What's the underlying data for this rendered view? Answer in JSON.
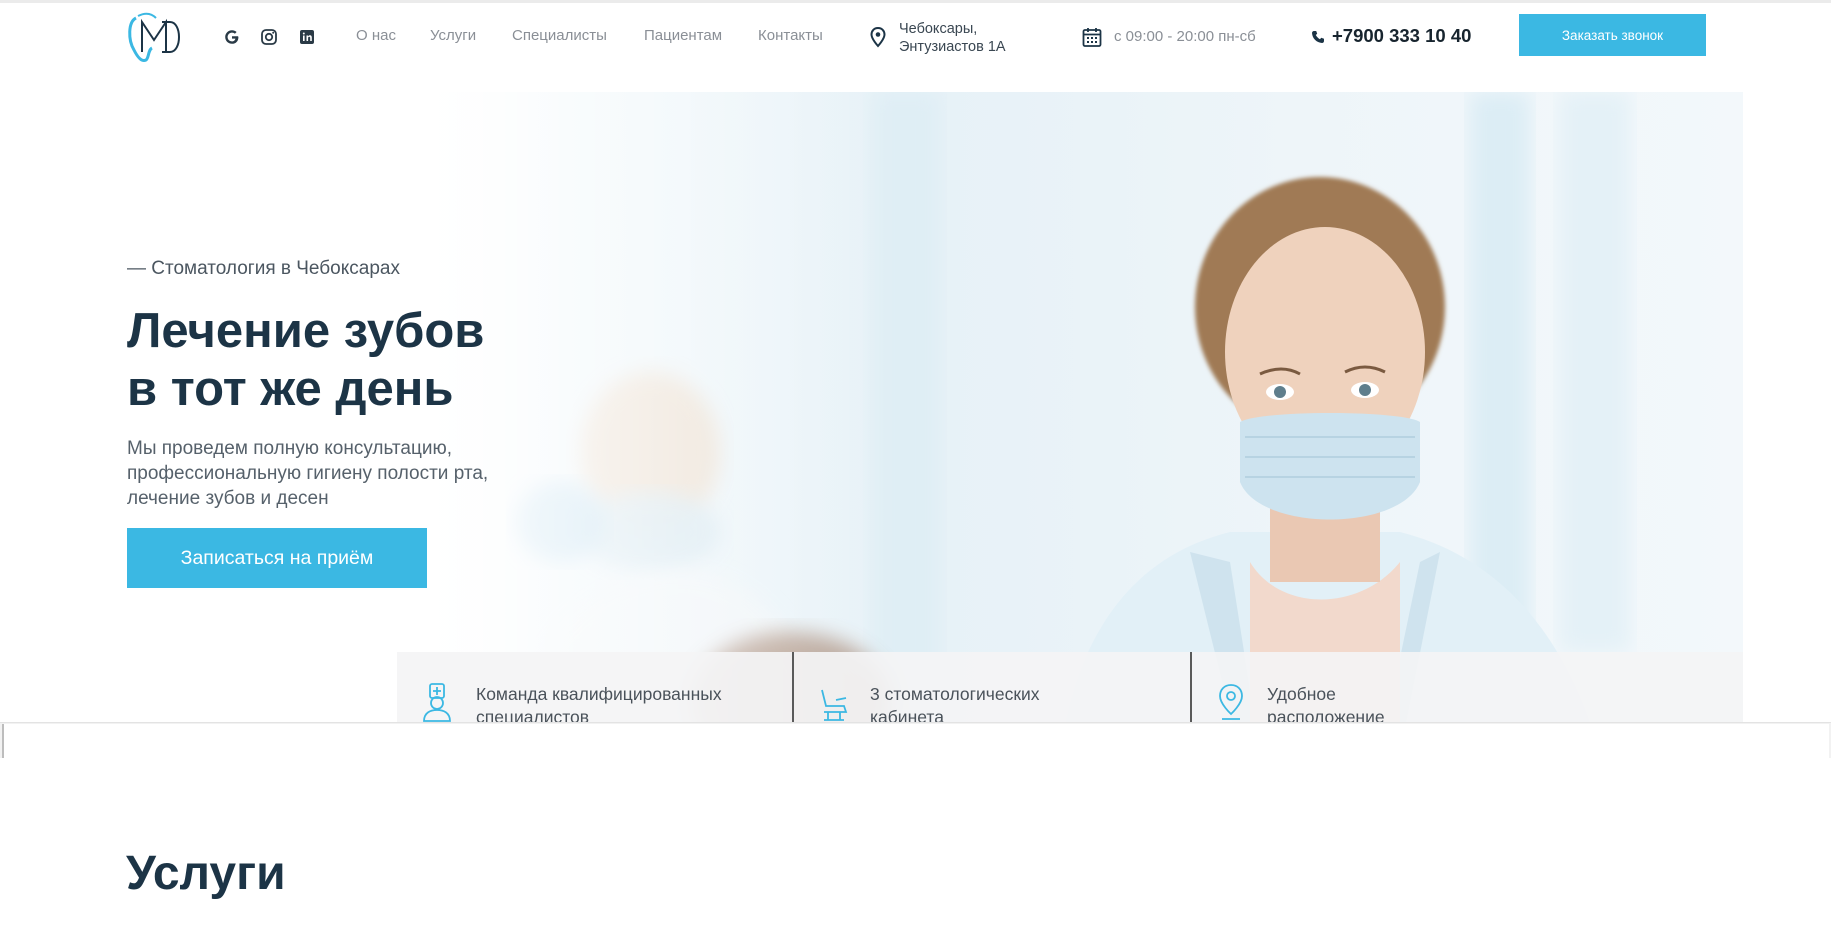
{
  "colors": {
    "accent": "#3bb8e3",
    "heading": "#1c3446",
    "nav_text": "#8a8f96"
  },
  "header": {
    "logo_text": "MD",
    "social": [
      {
        "icon": "google-icon"
      },
      {
        "icon": "instagram-icon"
      },
      {
        "icon": "linkedin-icon"
      }
    ],
    "nav": [
      "О нас",
      "Услуги",
      "Специалисты",
      "Пациентам",
      "Контакты"
    ],
    "address_line1": "Чебоксары,",
    "address_line2": "Энтузиастов 1А",
    "hours": "с 09:00 - 20:00 пн-сб",
    "phone": "+7900 333 10 40",
    "callback_label": "Заказать звонок"
  },
  "hero": {
    "kicker": "— Стоматология в Чебоксарах",
    "title_line1": "Лечение зубов",
    "title_line2": "в тот же день",
    "description": "Мы проведем полную консультацию, профессиональную гигиену полости рта, лечение зубов и десен",
    "cta_label": "Записаться на приём"
  },
  "features": [
    {
      "icon": "doctor-icon",
      "line1": "Команда квалифицированных",
      "line2": "специалистов"
    },
    {
      "icon": "dental-chair-icon",
      "line1": "3 стоматологических",
      "line2": "кабинета"
    },
    {
      "icon": "location-pin-icon",
      "line1": "Удобное",
      "line2": "расположение"
    }
  ],
  "services": {
    "title": "Услуги"
  }
}
